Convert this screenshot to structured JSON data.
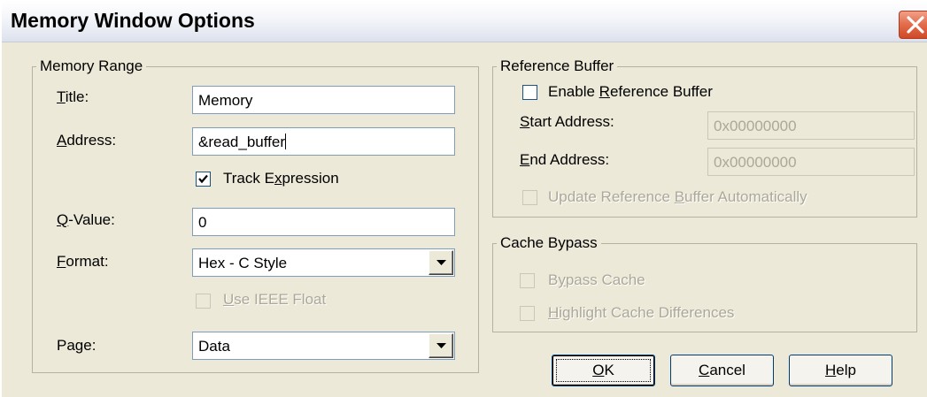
{
  "window": {
    "title": "Memory Window Options",
    "close_icon": "close-x-icon"
  },
  "memory_range": {
    "legend": "Memory Range",
    "title_label": {
      "mnemonic": "T",
      "rest": "itle:"
    },
    "title_value": "Memory",
    "address_label": {
      "mnemonic": "A",
      "rest": "ddress:"
    },
    "address_value": "&read_buffer",
    "track_expression": {
      "pre": "Track E",
      "mnemonic": "x",
      "post": "pression",
      "checked": true
    },
    "qvalue_label": {
      "mnemonic": "Q",
      "rest": "-Value:"
    },
    "qvalue_value": "0",
    "format_label": {
      "mnemonic": "F",
      "rest": "ormat:"
    },
    "format_value": "Hex - C Style",
    "use_ieee_float": {
      "mnemonic": "U",
      "rest": "se IEEE Float",
      "checked": false,
      "disabled": true
    },
    "page_label": "Page:",
    "page_value": "Data"
  },
  "reference_buffer": {
    "legend": "Reference Buffer",
    "enable": {
      "pre": "Enable ",
      "mnemonic": "R",
      "post": "eference Buffer",
      "checked": false
    },
    "start_label": {
      "mnemonic": "S",
      "rest": "tart Address:"
    },
    "start_value": "0x00000000",
    "end_label": {
      "mnemonic": "E",
      "rest": "nd Address:"
    },
    "end_value": "0x00000000",
    "update_auto": {
      "pre": "Update Reference ",
      "mnemonic": "B",
      "post": "uffer Automatically",
      "checked": false,
      "disabled": true
    }
  },
  "cache_bypass": {
    "legend": "Cache Bypass",
    "bypass": {
      "pre": "B",
      "mnemonic": "y",
      "post": "pass Cache",
      "checked": false,
      "disabled": true
    },
    "highlight": {
      "pre": "",
      "mnemonic": "H",
      "post": "ighlight Cache Differences",
      "checked": false,
      "disabled": true
    }
  },
  "buttons": {
    "ok": {
      "mnemonic": "O",
      "rest": "K"
    },
    "cancel": {
      "mnemonic": "C",
      "rest": "ancel"
    },
    "help": {
      "mnemonic": "H",
      "rest": "elp"
    }
  },
  "colors": {
    "dialog_bg": "#ece9d8",
    "close_button": "#e36b4a",
    "disabled_text": "#aca899",
    "input_border": "#7f9db9"
  }
}
